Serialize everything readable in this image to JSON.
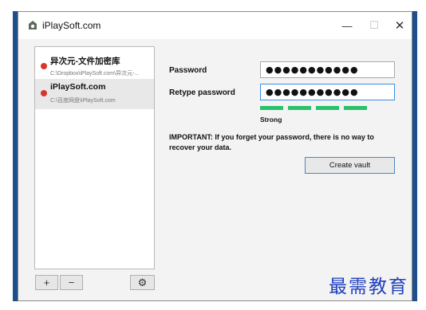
{
  "window": {
    "title": "iPlaySoft.com",
    "icon": "vault-logo-icon",
    "controls": {
      "minimize": "—",
      "maximize": "☐",
      "close": "✕"
    }
  },
  "sidebar": {
    "vaults": [
      {
        "name": "异次元-文件加密库",
        "path": "C:\\Dropbox\\iPlaySoft.com\\异次元-...",
        "selected": false,
        "status_color": "#d9342b"
      },
      {
        "name": "iPlaySoft.com",
        "path": "C:\\百度网盘\\iPlaySoft.com",
        "selected": true,
        "status_color": "#d9342b"
      }
    ],
    "buttons": {
      "add": "+",
      "remove": "−",
      "settings": "⚙"
    }
  },
  "form": {
    "password_label": "Password",
    "password_value": "●●●●●●●●●●●",
    "retype_label": "Retype password",
    "retype_value": "●●●●●●●●●●●",
    "strength": {
      "label": "Strong",
      "segments_filled": 4,
      "segments_total": 4,
      "color": "#27c26a"
    },
    "warning": "IMPORTANT: If you forget your password, there is no way to recover your data.",
    "create_button": "Create vault"
  },
  "watermark": "最需教育"
}
